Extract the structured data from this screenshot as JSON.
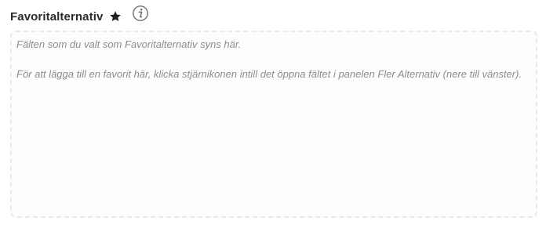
{
  "section": {
    "title": "Favoritalternativ",
    "star_icon": "star-icon",
    "info_icon": "info-icon"
  },
  "empty_state": {
    "line1": "Fälten som du valt som Favoritalternativ syns här.",
    "line2": "För att lägga till en favorit här, klicka stjärnikonen intill det öppna fältet i panelen Fler Alternativ (nere till vänster)."
  },
  "colors": {
    "title": "#2b2b2b",
    "hint_text": "#8c8c8c",
    "panel_border": "#e6e8f4",
    "icon": "#1e1e1e"
  }
}
